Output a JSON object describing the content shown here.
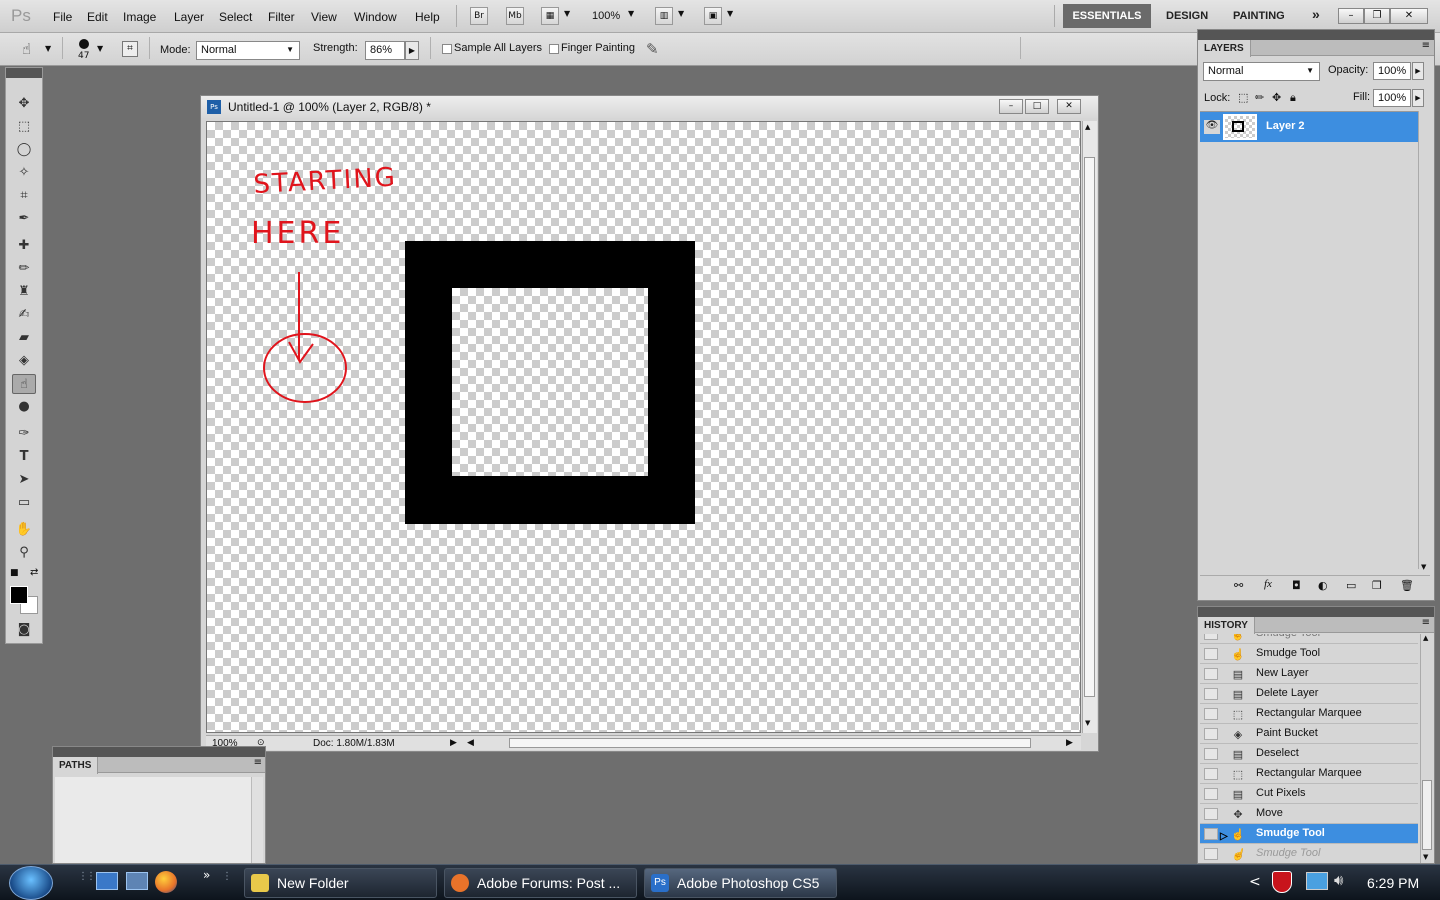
{
  "app": {
    "logo": "Ps",
    "title": "Untitled-1 @ 100% (Layer 2, RGB/8) *"
  },
  "menu": [
    "File",
    "Edit",
    "Image",
    "Layer",
    "Select",
    "Filter",
    "View",
    "Window",
    "Help"
  ],
  "appbar": {
    "bridge": "Br",
    "minibridge": "Mb",
    "zoom": "100%"
  },
  "workspaces": {
    "essentials": "ESSENTIALS",
    "design": "DESIGN",
    "painting": "PAINTING",
    "more": "»"
  },
  "options": {
    "brush_size": "47",
    "mode_label": "Mode:",
    "mode_value": "Normal",
    "strength_label": "Strength:",
    "strength_value": "86%",
    "sample_all_layers": "Sample All Layers",
    "finger_painting": "Finger Painting"
  },
  "canvas": {
    "annotation_line1": "STARTING",
    "annotation_line2": "HERE",
    "zoom": "100%",
    "doc_info": "Doc: 1.80M/1.83M"
  },
  "layers_panel": {
    "tab": "LAYERS",
    "blend_mode": "Normal",
    "opacity_label": "Opacity:",
    "opacity_value": "100%",
    "lock_label": "Lock:",
    "fill_label": "Fill:",
    "fill_value": "100%",
    "layers": [
      {
        "name": "Layer 2",
        "selected": true
      }
    ]
  },
  "history_panel": {
    "tab": "HISTORY",
    "items": [
      {
        "label": "Smudge Tool",
        "icon": "smudge-icon",
        "state": "partial"
      },
      {
        "label": "Smudge Tool",
        "icon": "smudge-icon",
        "state": "normal"
      },
      {
        "label": "New Layer",
        "icon": "doc-icon",
        "state": "normal"
      },
      {
        "label": "Delete Layer",
        "icon": "doc-icon",
        "state": "normal"
      },
      {
        "label": "Rectangular Marquee",
        "icon": "marquee-icon",
        "state": "normal"
      },
      {
        "label": "Paint Bucket",
        "icon": "bucket-icon",
        "state": "normal"
      },
      {
        "label": "Deselect",
        "icon": "doc-icon",
        "state": "normal"
      },
      {
        "label": "Rectangular Marquee",
        "icon": "marquee-icon",
        "state": "normal"
      },
      {
        "label": "Cut Pixels",
        "icon": "doc-icon",
        "state": "normal"
      },
      {
        "label": "Move",
        "icon": "move-icon",
        "state": "normal"
      },
      {
        "label": "Smudge Tool",
        "icon": "smudge-icon",
        "state": "selected"
      },
      {
        "label": "Smudge Tool",
        "icon": "smudge-icon",
        "state": "undone"
      }
    ]
  },
  "paths_panel": {
    "tab": "PATHS"
  },
  "taskbar": {
    "items": [
      {
        "label": "New Folder",
        "color": "#e8c84a"
      },
      {
        "label": "Adobe Forums: Post ...",
        "color": "#e8732a"
      },
      {
        "label": "Adobe Photoshop CS5",
        "color": "#2a6fc9"
      }
    ],
    "clock": "6:29 PM"
  },
  "colors": {
    "accent": "#3d8ee0",
    "annotation": "#e0141c",
    "foreground": "#000000",
    "background": "#ffffff"
  }
}
